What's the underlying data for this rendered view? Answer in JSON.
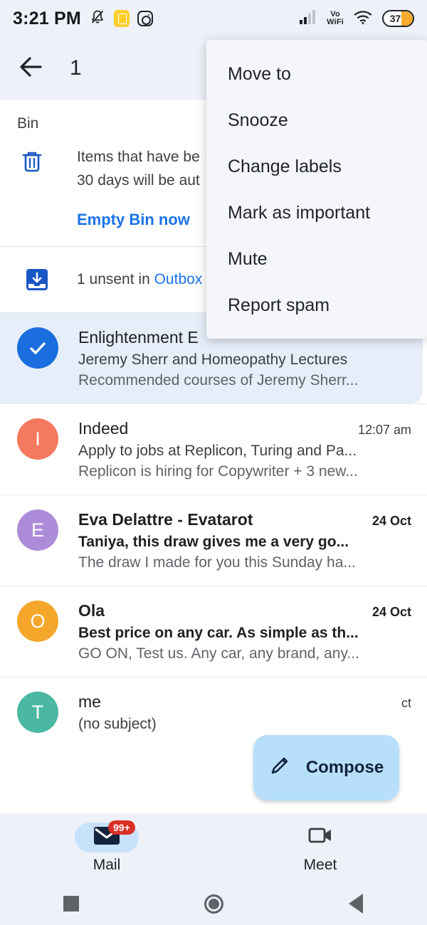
{
  "status_bar": {
    "time": "3:21 PM",
    "left_icons": [
      "notifications-off-icon",
      "app-yellow-icon",
      "instagram-icon"
    ],
    "signal_icon": "cellular-signal-icon",
    "vowifi_line1": "Vo",
    "vowifi_line2": "WiFi",
    "wifi_icon": "wifi-icon",
    "battery_percent": "37"
  },
  "action_bar": {
    "back_icon": "back-arrow-icon",
    "selection_count": "1"
  },
  "bin": {
    "label": "Bin",
    "icon": "trash-icon",
    "line1": "Items that have be",
    "line2": "30 days will be aut",
    "empty_link": "Empty Bin now"
  },
  "outbox": {
    "icon": "outbox-icon",
    "prefix": "1 unsent in ",
    "link": "Outbox"
  },
  "emails": [
    {
      "avatar_type": "check",
      "avatar_letter": "",
      "avatar_color": "#1a6ede",
      "sender": "Enlightenment E",
      "date": "",
      "subject": "Jeremy Sherr and Homeopathy Lectures",
      "snippet": "Recommended courses of Jeremy Sherr...",
      "unread": false,
      "selected": true
    },
    {
      "avatar_type": "letter",
      "avatar_letter": "I",
      "avatar_color": "#F4795F",
      "sender": "Indeed",
      "date": "12:07 am",
      "subject": "Apply to jobs at Replicon, Turing and Pa...",
      "snippet": "Replicon is hiring for Copywriter + 3 new...",
      "unread": false,
      "selected": false
    },
    {
      "avatar_type": "letter",
      "avatar_letter": "E",
      "avatar_color": "#AC8CD8",
      "sender": "Eva Delattre - Evatarot",
      "date": "24 Oct",
      "subject": "Taniya, this draw gives me a very go...",
      "snippet": "The draw I made for you this Sunday ha...",
      "unread": true,
      "selected": false
    },
    {
      "avatar_type": "letter",
      "avatar_letter": "O",
      "avatar_color": "#F4A72A",
      "sender": "Ola",
      "date": "24 Oct",
      "subject": "Best price on any car. As simple as th...",
      "snippet": "GO ON, Test us. Any car, any brand, any...",
      "unread": true,
      "selected": false
    },
    {
      "avatar_type": "letter",
      "avatar_letter": "T",
      "avatar_color": "#4BB8A4",
      "sender": "me",
      "date": "ct",
      "subject": "(no subject)",
      "snippet": "",
      "unread": false,
      "selected": false
    }
  ],
  "compose": {
    "label": "Compose",
    "icon": "pencil-icon"
  },
  "bottom_nav": {
    "tabs": [
      {
        "label": "Mail",
        "icon": "envelope-icon",
        "badge": "99+",
        "active": true
      },
      {
        "label": "Meet",
        "icon": "video-camera-icon",
        "badge": "",
        "active": false
      }
    ]
  },
  "menu": {
    "items": [
      "Move to",
      "Snooze",
      "Change labels",
      "Mark as important",
      "Mute",
      "Report spam"
    ]
  },
  "android_nav": {
    "recents_icon": "square-recents-icon",
    "home_icon": "circle-home-icon",
    "back_icon": "triangle-back-icon"
  },
  "colors": {
    "page_bg": "#eef1f8",
    "sheet_bg": "#ffffff",
    "accent_blue": "#1a73e8",
    "selected_row": "#e6eefa",
    "compose_bg": "#b7dffc",
    "badge_red": "#d93025",
    "battery_fill": "#F9AB2E"
  }
}
